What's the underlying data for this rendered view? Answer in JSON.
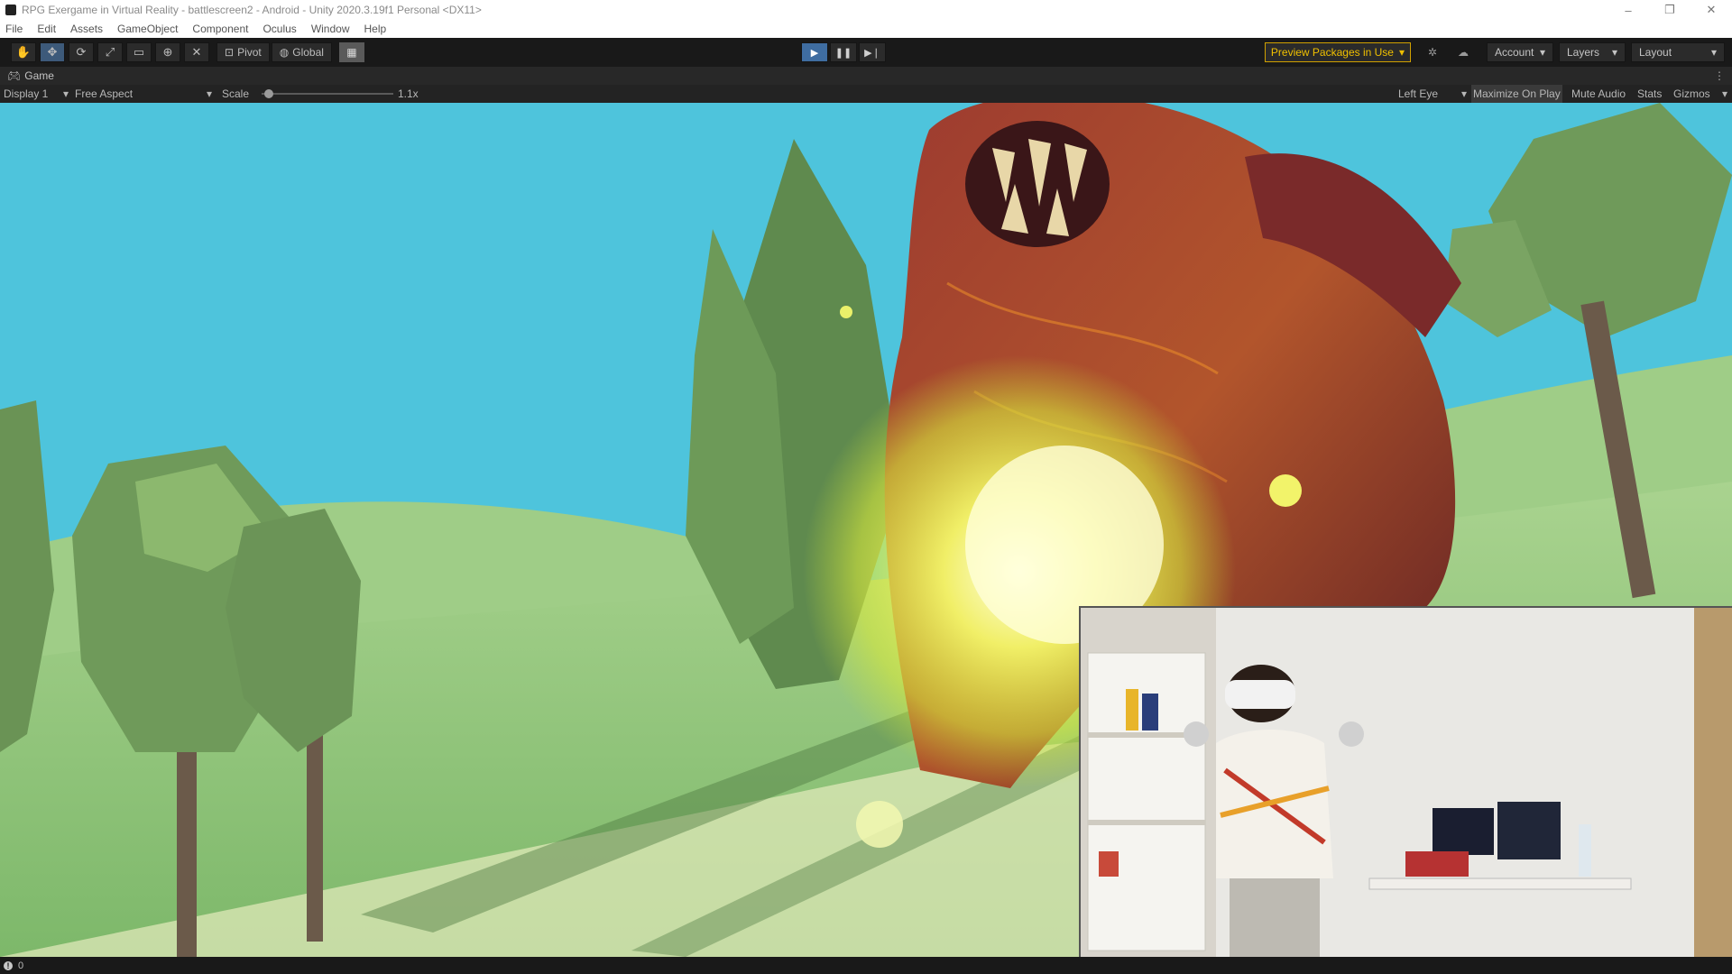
{
  "window": {
    "title": "RPG Exergame in Virtual Reality - battlescreen2 - Android - Unity 2020.3.19f1 Personal <DX11>",
    "controls": [
      "–",
      "❐",
      "✕"
    ]
  },
  "menu": [
    "File",
    "Edit",
    "Assets",
    "GameObject",
    "Component",
    "Oculus",
    "Window",
    "Help"
  ],
  "toolbar": {
    "tools": [
      "hand-tool-icon",
      "move-tool-icon",
      "rotate-tool-icon",
      "scale-tool-icon",
      "rect-tool-icon",
      "transform-tool-icon",
      "custom-tool-icon"
    ],
    "pivot_label": "Pivot",
    "global_label": "Global",
    "preview_packages": "Preview Packages in Use",
    "account": "Account",
    "layers": "Layers",
    "layout": "Layout"
  },
  "playback": {
    "playing": true,
    "paused": false
  },
  "game_tab": {
    "label": "Game"
  },
  "game_controls": {
    "display": "Display 1",
    "aspect": "Free Aspect",
    "scale_label": "Scale",
    "scale_value": "1.1x",
    "scale_fraction": 0.02,
    "eye": "Left Eye",
    "maximize": "Maximize On Play",
    "mute": "Mute Audio",
    "stats": "Stats",
    "gizmos": "Gizmos"
  },
  "colors": {
    "sky": "#4ec4dc",
    "grass": "#8fc87a",
    "tree_foliage": "#6f9a5a",
    "monster": "#7a2a2a",
    "blast": "#e8f05a",
    "preview_accent": "#f0c000",
    "play_active": "#3f6da1"
  },
  "status": {
    "count": "0"
  }
}
